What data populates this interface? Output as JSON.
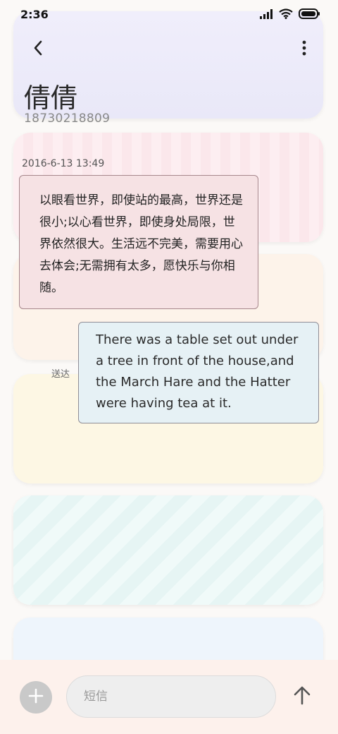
{
  "status_bar": {
    "time": "2:36"
  },
  "contact": {
    "name": "倩倩",
    "phone": "18730218809"
  },
  "conversation": {
    "timestamp": "2016-6-13 13:49",
    "messages": [
      {
        "direction": "incoming",
        "text": "以眼看世界，即使站的最高，世界还是很小;以心看世界，即使身处局限，世界依然很大。生活远不完美，需要用心去体会;无需拥有太多，愿快乐与你相随。"
      },
      {
        "direction": "outgoing",
        "text": "There was a table set out under a tree in front of the house,and the March Hare and the Hatter were having tea at it.",
        "status": "送达"
      }
    ]
  },
  "composer": {
    "placeholder": "短信"
  },
  "icons": {
    "back": "chevron-left-icon",
    "more": "more-vertical-icon",
    "add": "plus-icon",
    "send": "arrow-up-icon",
    "signal": "signal-icon",
    "wifi": "wifi-icon",
    "battery": "battery-icon"
  }
}
